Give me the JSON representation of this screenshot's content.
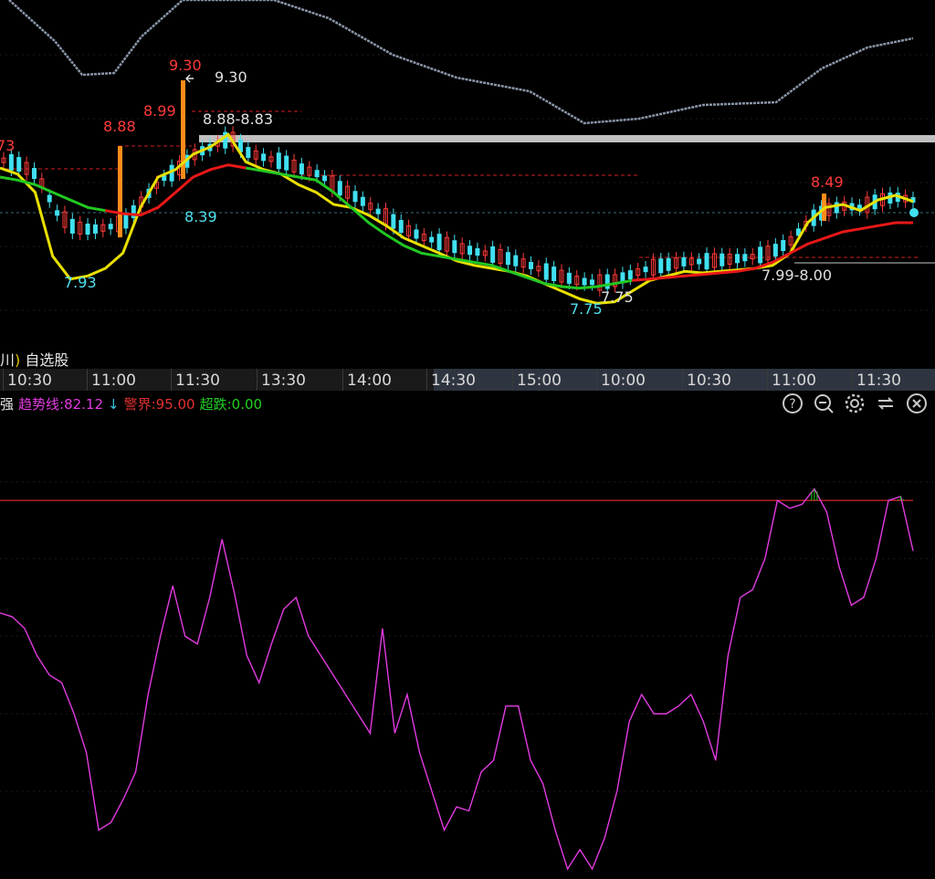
{
  "main": {
    "price_labels": [
      {
        "text": "73",
        "kind": "red"
      },
      {
        "text": "8.88",
        "kind": "red"
      },
      {
        "text": "8.99",
        "kind": "red"
      },
      {
        "text": "9.30",
        "kind": "red"
      },
      {
        "text": "9.30",
        "kind": "white"
      },
      {
        "text": "8.88-8.83",
        "kind": "white"
      },
      {
        "text": "8.39",
        "kind": "cyan"
      },
      {
        "text": "7.93",
        "kind": "cyan"
      },
      {
        "text": "7.75",
        "kind": "white"
      },
      {
        "text": "7.75",
        "kind": "cyan"
      },
      {
        "text": "8.49",
        "kind": "red"
      },
      {
        "text": "7.99-8.00",
        "kind": "white"
      }
    ]
  },
  "watchlist": {
    "paren": ")",
    "label": "自选股",
    "prefix": "川"
  },
  "time_axis": {
    "ticks": [
      "10:30",
      "11:00",
      "11:30",
      "13:30",
      "14:00",
      "14:30",
      "15:00",
      "10:00",
      "10:30",
      "11:00",
      "11:30"
    ]
  },
  "indicator": {
    "name_fragment": "强",
    "trend_label": "趋势线:82.12",
    "arrow": "↓",
    "warn_label": "警界:95.00",
    "drop_label": "超跌:0.00",
    "colors": {
      "trend": "#e23be0",
      "warn": "#e03030",
      "drop": "#22d022",
      "arrow": "#36c8e0"
    }
  },
  "toolbar": {
    "buttons": [
      {
        "icon": "help-icon"
      },
      {
        "icon": "zoom-out-icon"
      },
      {
        "icon": "settings-icon"
      },
      {
        "icon": "refresh-icon"
      },
      {
        "icon": "close-icon"
      }
    ]
  },
  "chart_data": [
    {
      "type": "line",
      "note_type": "intraday price chart",
      "series": [
        {
          "values": [
            8.66,
            8.62,
            8.5,
            8.08,
            7.93,
            7.95,
            8.0,
            8.1,
            8.4,
            8.6,
            8.65,
            8.75,
            8.8,
            8.88,
            8.7,
            8.65,
            8.62,
            8.55,
            8.5,
            8.42,
            8.4,
            8.35,
            8.28,
            8.2,
            8.15,
            8.1,
            8.05,
            8.02,
            8.0,
            7.98,
            7.95,
            7.9,
            7.85,
            7.8,
            7.77,
            7.78,
            7.85,
            7.92,
            7.95,
            7.98,
            7.97,
            7.98,
            7.99,
            8.0,
            8.02,
            8.1,
            8.3,
            8.4,
            8.42,
            8.38,
            8.45,
            8.48,
            8.44
          ],
          "color": "#e8e000"
        },
        {
          "values": [
            8.6,
            8.58,
            8.55,
            8.5,
            8.45,
            8.4,
            8.38,
            8.36,
            8.35,
            8.4,
            8.5,
            8.6,
            8.65,
            8.68,
            8.66,
            8.64,
            8.62,
            8.6,
            8.58,
            8.5,
            8.4,
            8.3,
            8.22,
            8.15,
            8.1,
            8.08,
            8.06,
            8.04,
            8.02,
            7.98,
            7.94,
            7.9,
            7.88,
            7.87,
            7.88,
            7.9,
            7.92,
            7.93,
            7.94,
            7.95,
            7.96,
            7.97,
            7.98,
            8.0,
            8.04,
            8.1,
            8.16,
            8.2,
            8.24,
            8.26,
            8.28,
            8.3,
            8.3
          ],
          "color": "#22c822"
        }
      ],
      "ylim": [
        7.7,
        9.5
      ]
    },
    {
      "type": "line",
      "series": [
        {
          "values": [
            66,
            65,
            62,
            55,
            50,
            48,
            40,
            30,
            10,
            12,
            18,
            25,
            45,
            60,
            73,
            60,
            58,
            70,
            85,
            71,
            55,
            48,
            58,
            67,
            70,
            60,
            55,
            50,
            45,
            40,
            35,
            62,
            35,
            45,
            30,
            20,
            10,
            16,
            15,
            25,
            28,
            42,
            42,
            28,
            22,
            10,
            0,
            5,
            0,
            8,
            20,
            38,
            45,
            40,
            40,
            42,
            45,
            38,
            28,
            55,
            70,
            72,
            80,
            95,
            93,
            94,
            98,
            92,
            78,
            68,
            70,
            80,
            95,
            96,
            82
          ],
          "color": "#e23be0"
        }
      ],
      "ylim": [
        0,
        100
      ],
      "hlines": [
        {
          "y": 95,
          "label": "警界"
        }
      ]
    }
  ]
}
